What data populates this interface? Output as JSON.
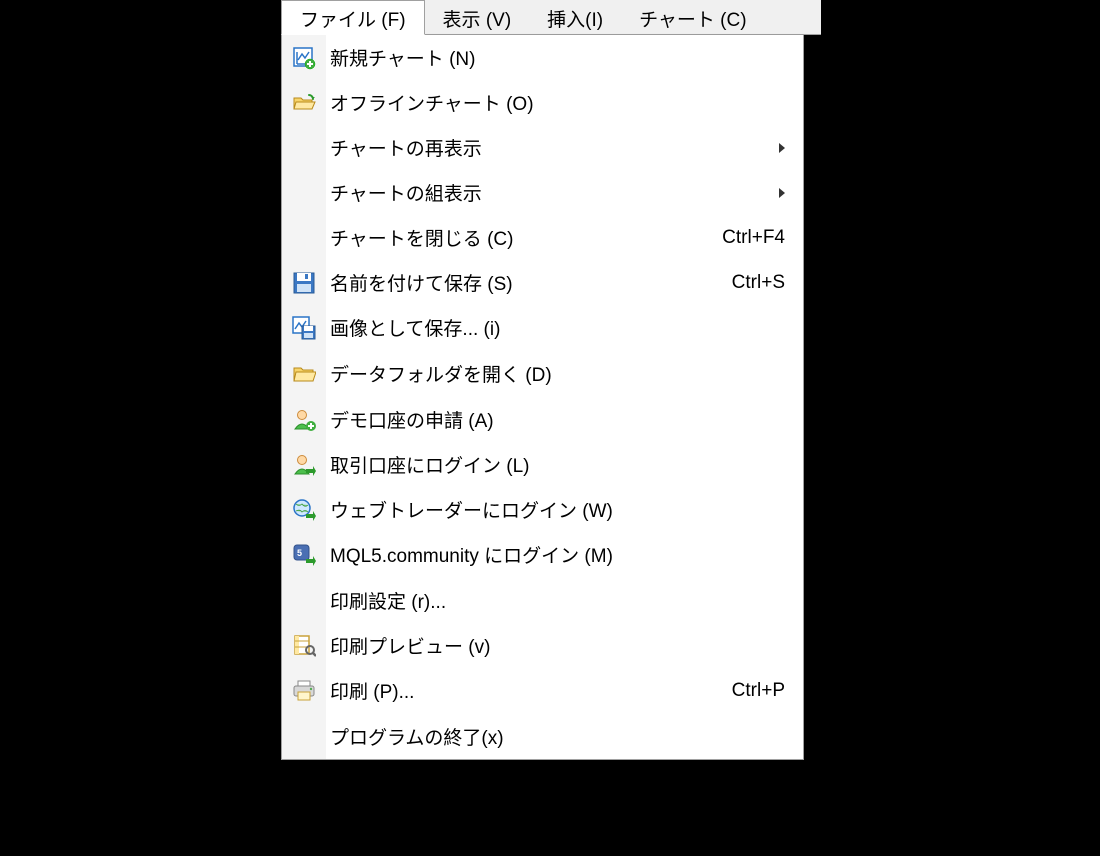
{
  "menubar": {
    "file": "ファイル (F)",
    "view": "表示 (V)",
    "insert": "挿入(I)",
    "chart": "チャート (C)"
  },
  "menu": {
    "new_chart": "新規チャート (N)",
    "offline_chart": "オフラインチャート (O)",
    "redisplay_chart": "チャートの再表示",
    "chart_profiles": "チャートの組表示",
    "close_chart": "チャートを閉じる (C)",
    "close_chart_sc": "Ctrl+F4",
    "save_as": "名前を付けて保存 (S)",
    "save_as_sc": "Ctrl+S",
    "save_image": "画像として保存... (i)",
    "open_data_folder": "データフォルダを開く (D)",
    "demo_account": "デモ口座の申請 (A)",
    "login_account": "取引口座にログイン (L)",
    "login_webtrader": "ウェブトレーダーにログイン (W)",
    "login_mql5": "MQL5.community にログイン (M)",
    "print_setup": "印刷設定 (r)...",
    "print_preview": "印刷プレビュー (v)",
    "print": "印刷 (P)...",
    "print_sc": "Ctrl+P",
    "exit": "プログラムの終了(x)"
  }
}
